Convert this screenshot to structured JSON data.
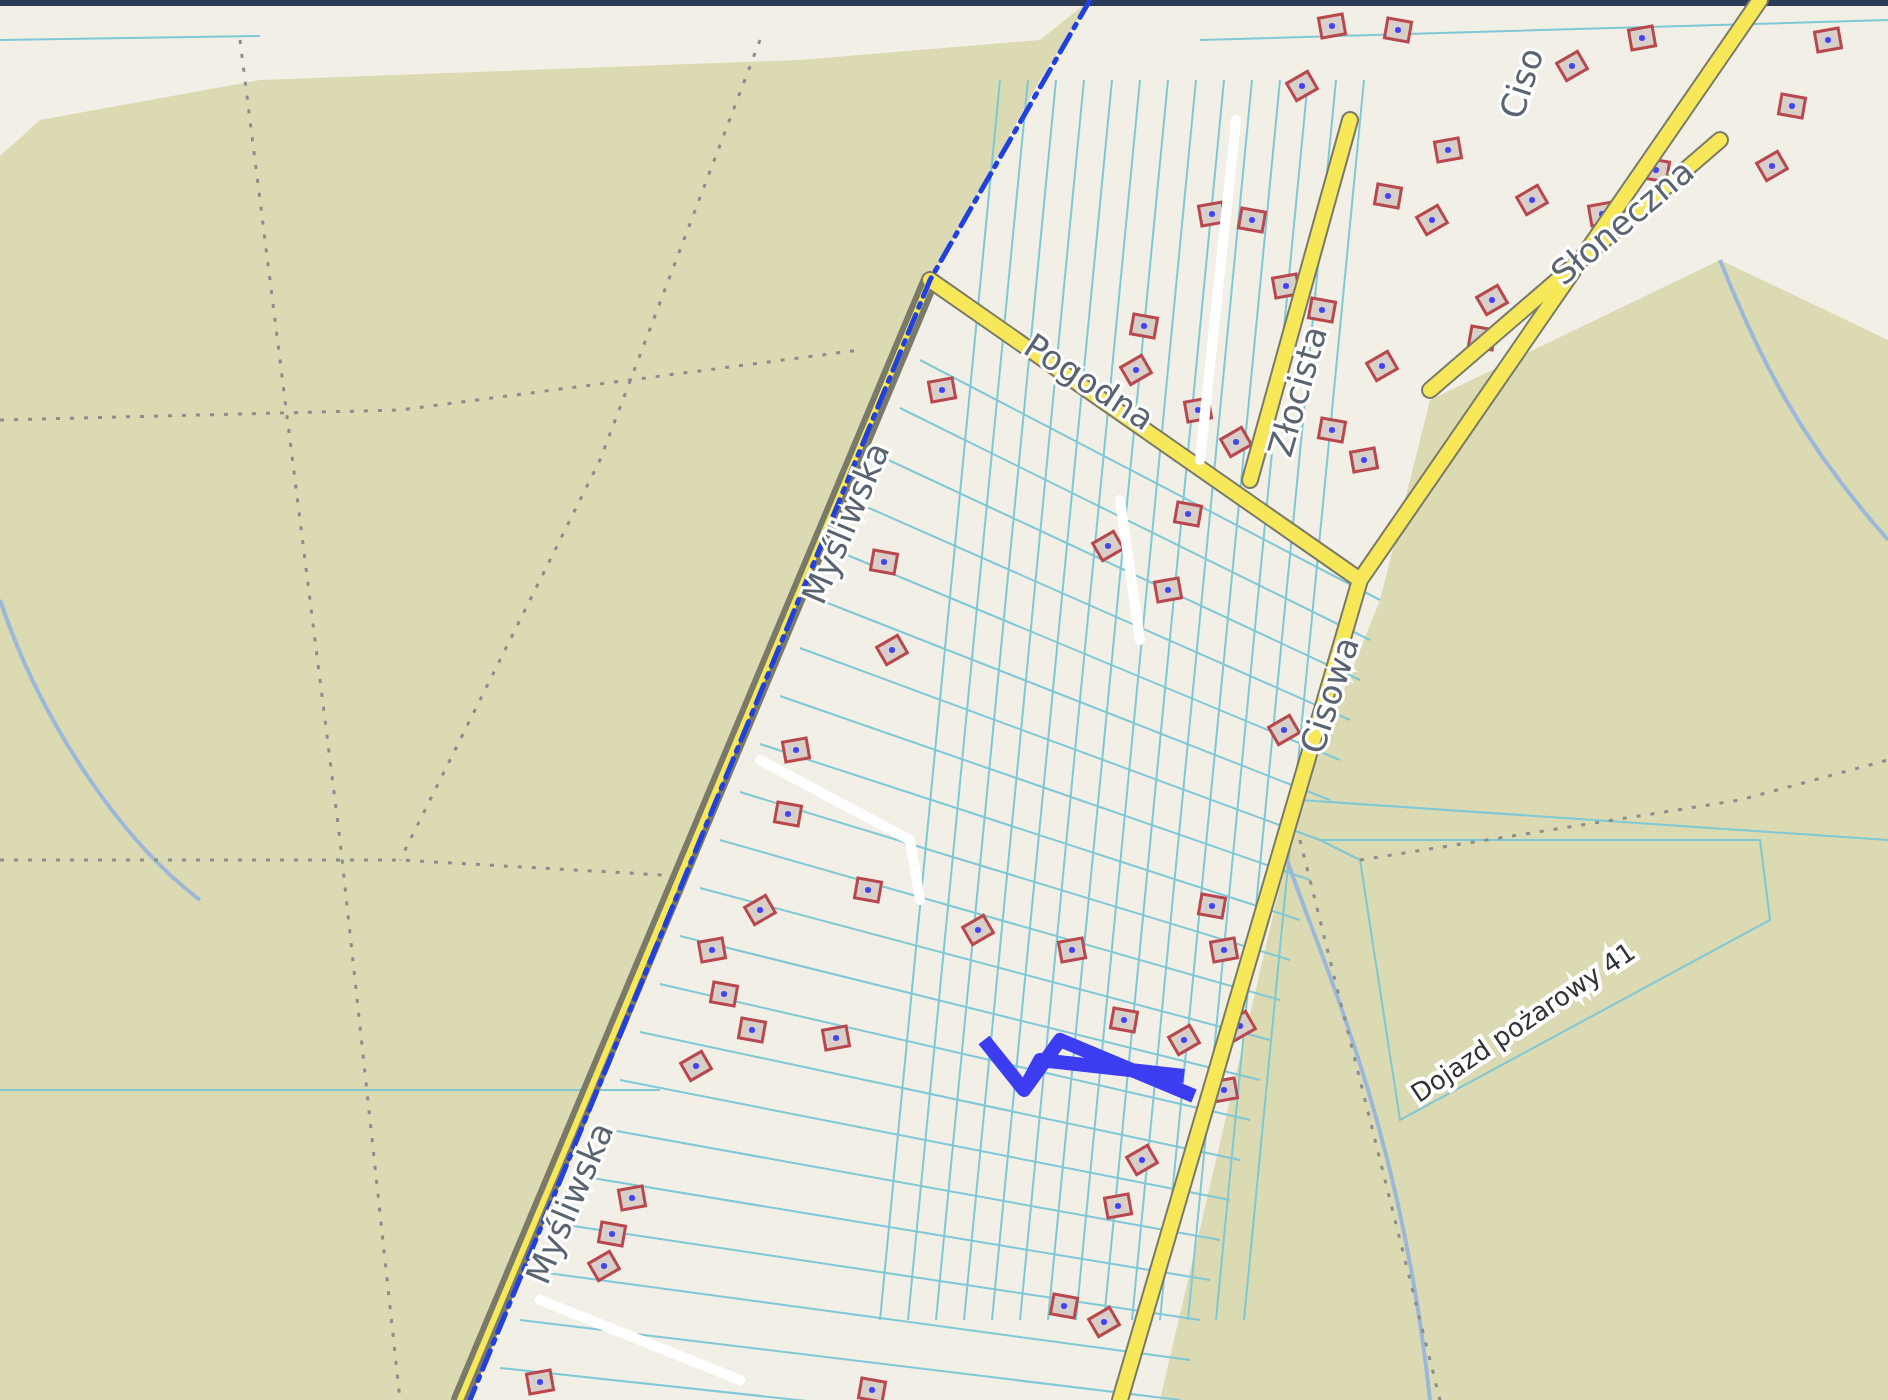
{
  "map": {
    "labels": [
      {
        "text": "Ciso",
        "kind": "street"
      },
      {
        "text": "Słoneczna",
        "kind": "street"
      },
      {
        "text": "Złocista",
        "kind": "street"
      },
      {
        "text": "Pogodna",
        "kind": "street"
      },
      {
        "text": "Cisowa",
        "kind": "street"
      },
      {
        "text": "Myśliwska",
        "kind": "street"
      },
      {
        "text": "Myśliwska",
        "kind": "street"
      },
      {
        "text": "Dojazd pożarowy 41",
        "kind": "track"
      }
    ]
  }
}
